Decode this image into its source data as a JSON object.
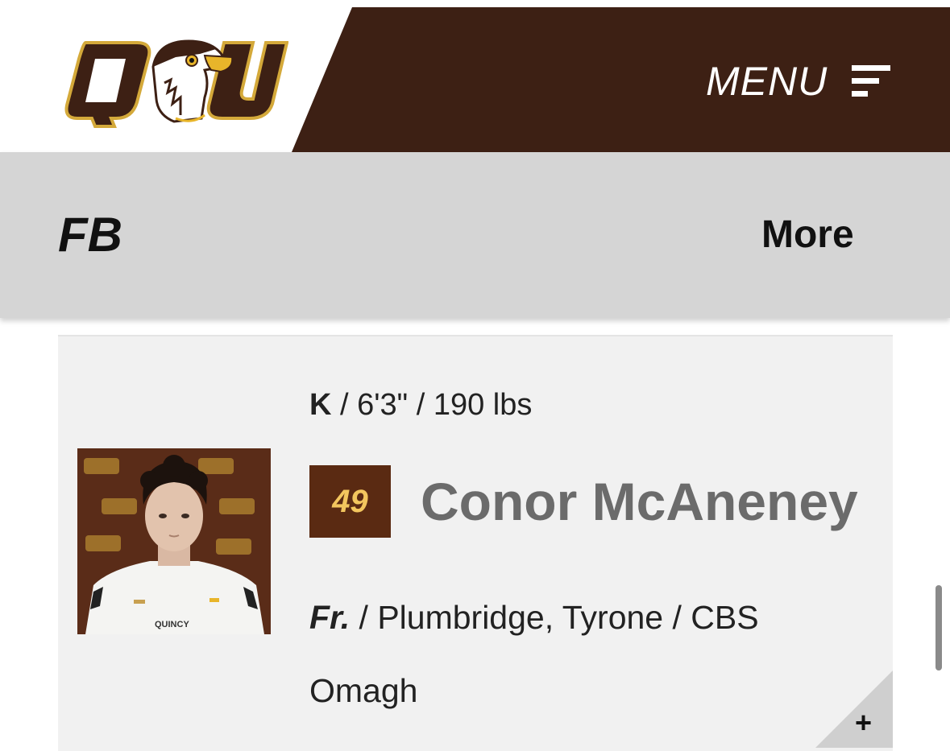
{
  "header": {
    "menu_label": "MENU",
    "logo_icon": "qu-hawk-logo",
    "menu_icon": "menu-lines-icon",
    "colors": {
      "brand_brown": "#3d2014",
      "gold": "#f3c65e"
    }
  },
  "subnav": {
    "title": "FB",
    "more_label": "More"
  },
  "player": {
    "position": "K",
    "height": "6'3\"",
    "weight": "190 lbs",
    "number": "49",
    "name": "Conor McAneney",
    "year": "Fr.",
    "hometown": "Plumbridge, Tyrone",
    "school": "CBS Omagh",
    "separator": " / ",
    "expand_label": "+"
  }
}
